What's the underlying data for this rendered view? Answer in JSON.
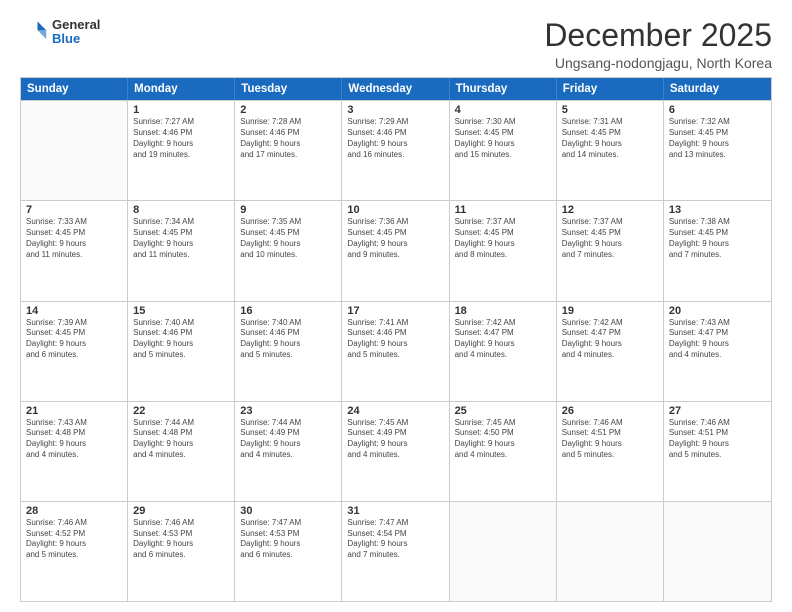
{
  "logo": {
    "general": "General",
    "blue": "Blue"
  },
  "header": {
    "month": "December 2025",
    "location": "Ungsang-nodongjagu, North Korea"
  },
  "weekdays": [
    "Sunday",
    "Monday",
    "Tuesday",
    "Wednesday",
    "Thursday",
    "Friday",
    "Saturday"
  ],
  "rows": [
    [
      {
        "day": "",
        "lines": []
      },
      {
        "day": "1",
        "lines": [
          "Sunrise: 7:27 AM",
          "Sunset: 4:46 PM",
          "Daylight: 9 hours",
          "and 19 minutes."
        ]
      },
      {
        "day": "2",
        "lines": [
          "Sunrise: 7:28 AM",
          "Sunset: 4:46 PM",
          "Daylight: 9 hours",
          "and 17 minutes."
        ]
      },
      {
        "day": "3",
        "lines": [
          "Sunrise: 7:29 AM",
          "Sunset: 4:46 PM",
          "Daylight: 9 hours",
          "and 16 minutes."
        ]
      },
      {
        "day": "4",
        "lines": [
          "Sunrise: 7:30 AM",
          "Sunset: 4:45 PM",
          "Daylight: 9 hours",
          "and 15 minutes."
        ]
      },
      {
        "day": "5",
        "lines": [
          "Sunrise: 7:31 AM",
          "Sunset: 4:45 PM",
          "Daylight: 9 hours",
          "and 14 minutes."
        ]
      },
      {
        "day": "6",
        "lines": [
          "Sunrise: 7:32 AM",
          "Sunset: 4:45 PM",
          "Daylight: 9 hours",
          "and 13 minutes."
        ]
      }
    ],
    [
      {
        "day": "7",
        "lines": [
          "Sunrise: 7:33 AM",
          "Sunset: 4:45 PM",
          "Daylight: 9 hours",
          "and 11 minutes."
        ]
      },
      {
        "day": "8",
        "lines": [
          "Sunrise: 7:34 AM",
          "Sunset: 4:45 PM",
          "Daylight: 9 hours",
          "and 11 minutes."
        ]
      },
      {
        "day": "9",
        "lines": [
          "Sunrise: 7:35 AM",
          "Sunset: 4:45 PM",
          "Daylight: 9 hours",
          "and 10 minutes."
        ]
      },
      {
        "day": "10",
        "lines": [
          "Sunrise: 7:36 AM",
          "Sunset: 4:45 PM",
          "Daylight: 9 hours",
          "and 9 minutes."
        ]
      },
      {
        "day": "11",
        "lines": [
          "Sunrise: 7:37 AM",
          "Sunset: 4:45 PM",
          "Daylight: 9 hours",
          "and 8 minutes."
        ]
      },
      {
        "day": "12",
        "lines": [
          "Sunrise: 7:37 AM",
          "Sunset: 4:45 PM",
          "Daylight: 9 hours",
          "and 7 minutes."
        ]
      },
      {
        "day": "13",
        "lines": [
          "Sunrise: 7:38 AM",
          "Sunset: 4:45 PM",
          "Daylight: 9 hours",
          "and 7 minutes."
        ]
      }
    ],
    [
      {
        "day": "14",
        "lines": [
          "Sunrise: 7:39 AM",
          "Sunset: 4:45 PM",
          "Daylight: 9 hours",
          "and 6 minutes."
        ]
      },
      {
        "day": "15",
        "lines": [
          "Sunrise: 7:40 AM",
          "Sunset: 4:46 PM",
          "Daylight: 9 hours",
          "and 5 minutes."
        ]
      },
      {
        "day": "16",
        "lines": [
          "Sunrise: 7:40 AM",
          "Sunset: 4:46 PM",
          "Daylight: 9 hours",
          "and 5 minutes."
        ]
      },
      {
        "day": "17",
        "lines": [
          "Sunrise: 7:41 AM",
          "Sunset: 4:46 PM",
          "Daylight: 9 hours",
          "and 5 minutes."
        ]
      },
      {
        "day": "18",
        "lines": [
          "Sunrise: 7:42 AM",
          "Sunset: 4:47 PM",
          "Daylight: 9 hours",
          "and 4 minutes."
        ]
      },
      {
        "day": "19",
        "lines": [
          "Sunrise: 7:42 AM",
          "Sunset: 4:47 PM",
          "Daylight: 9 hours",
          "and 4 minutes."
        ]
      },
      {
        "day": "20",
        "lines": [
          "Sunrise: 7:43 AM",
          "Sunset: 4:47 PM",
          "Daylight: 9 hours",
          "and 4 minutes."
        ]
      }
    ],
    [
      {
        "day": "21",
        "lines": [
          "Sunrise: 7:43 AM",
          "Sunset: 4:48 PM",
          "Daylight: 9 hours",
          "and 4 minutes."
        ]
      },
      {
        "day": "22",
        "lines": [
          "Sunrise: 7:44 AM",
          "Sunset: 4:48 PM",
          "Daylight: 9 hours",
          "and 4 minutes."
        ]
      },
      {
        "day": "23",
        "lines": [
          "Sunrise: 7:44 AM",
          "Sunset: 4:49 PM",
          "Daylight: 9 hours",
          "and 4 minutes."
        ]
      },
      {
        "day": "24",
        "lines": [
          "Sunrise: 7:45 AM",
          "Sunset: 4:49 PM",
          "Daylight: 9 hours",
          "and 4 minutes."
        ]
      },
      {
        "day": "25",
        "lines": [
          "Sunrise: 7:45 AM",
          "Sunset: 4:50 PM",
          "Daylight: 9 hours",
          "and 4 minutes."
        ]
      },
      {
        "day": "26",
        "lines": [
          "Sunrise: 7:46 AM",
          "Sunset: 4:51 PM",
          "Daylight: 9 hours",
          "and 5 minutes."
        ]
      },
      {
        "day": "27",
        "lines": [
          "Sunrise: 7:46 AM",
          "Sunset: 4:51 PM",
          "Daylight: 9 hours",
          "and 5 minutes."
        ]
      }
    ],
    [
      {
        "day": "28",
        "lines": [
          "Sunrise: 7:46 AM",
          "Sunset: 4:52 PM",
          "Daylight: 9 hours",
          "and 5 minutes."
        ]
      },
      {
        "day": "29",
        "lines": [
          "Sunrise: 7:46 AM",
          "Sunset: 4:53 PM",
          "Daylight: 9 hours",
          "and 6 minutes."
        ]
      },
      {
        "day": "30",
        "lines": [
          "Sunrise: 7:47 AM",
          "Sunset: 4:53 PM",
          "Daylight: 9 hours",
          "and 6 minutes."
        ]
      },
      {
        "day": "31",
        "lines": [
          "Sunrise: 7:47 AM",
          "Sunset: 4:54 PM",
          "Daylight: 9 hours",
          "and 7 minutes."
        ]
      },
      {
        "day": "",
        "lines": []
      },
      {
        "day": "",
        "lines": []
      },
      {
        "day": "",
        "lines": []
      }
    ]
  ]
}
